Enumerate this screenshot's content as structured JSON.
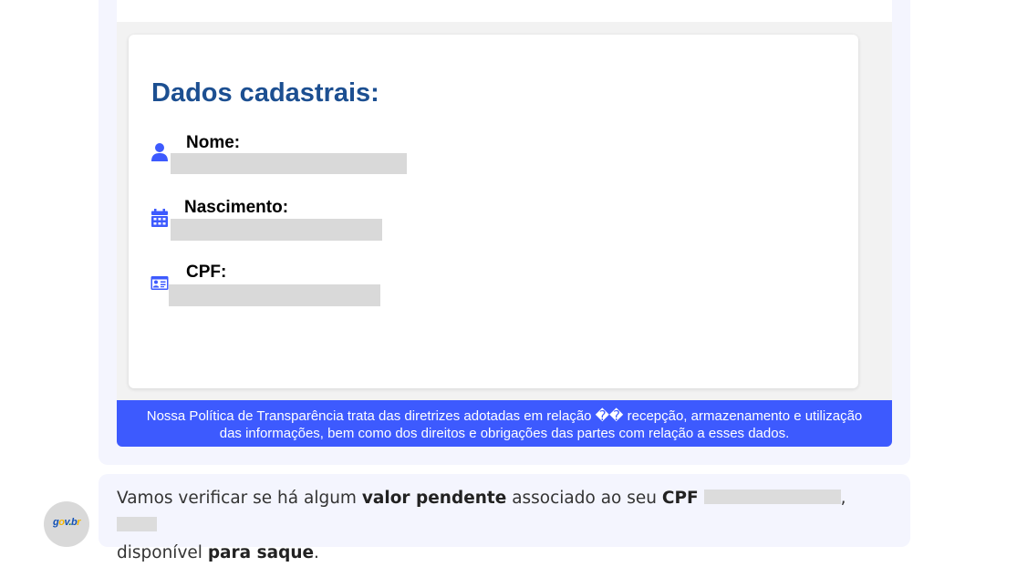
{
  "card": {
    "title": "Dados cadastrais:",
    "fields": [
      {
        "label": "Nome:",
        "icon": "user-icon"
      },
      {
        "label": "Nascimento:",
        "icon": "calendar-icon"
      },
      {
        "label": "CPF:",
        "icon": "id-card-icon"
      }
    ]
  },
  "notice": {
    "text": "Nossa Política de Transparência trata das diretrizes adotadas em relação �� recepção, armazenamento e utilização das informações, bem como dos direitos e obrigações das partes com relação a esses dados."
  },
  "message": {
    "part1": "Vamos verificar se há algum ",
    "bold1": "valor pendente",
    "part2": " associado ao seu ",
    "bold2": "CPF",
    "part3": ", ",
    "part4": "disponível ",
    "bold3": "para saque",
    "part5": "."
  },
  "avatar": {
    "logo_g": "g",
    "logo_o": "o",
    "logo_v": "v",
    "logo_dot": ".",
    "logo_b": "b",
    "logo_r": "r"
  },
  "colors": {
    "title": "#1c4f91",
    "notice_bg": "#3d5afe",
    "icon": "#3d5afe",
    "bubble_bg": "#f4f5fe"
  }
}
